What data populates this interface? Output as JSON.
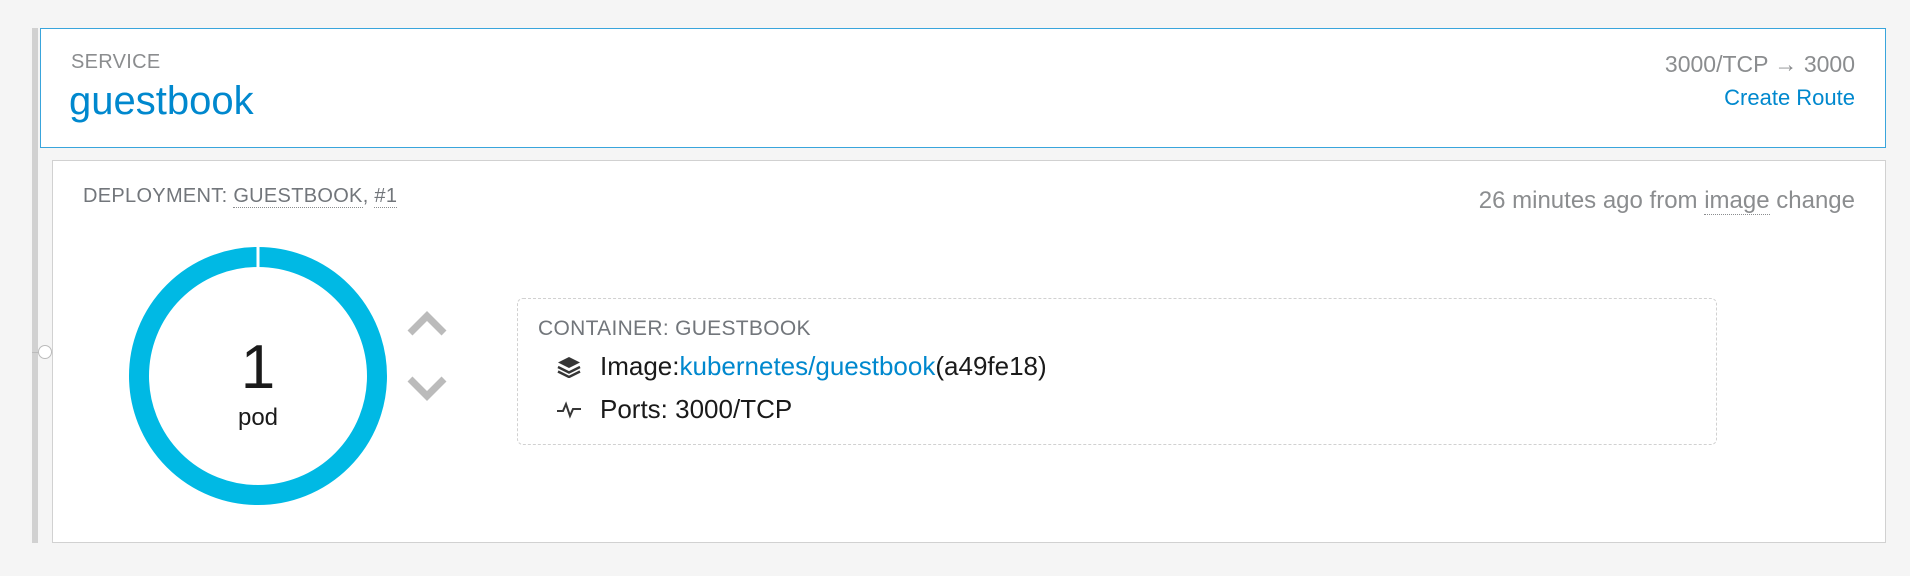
{
  "service": {
    "kind_label": "SERVICE",
    "name": "guestbook",
    "ports": "3000/TCP → 3000",
    "create_route_label": "Create Route"
  },
  "deployment": {
    "label_prefix": "DEPLOYMENT: ",
    "name": "GUESTBOOK",
    "separator": ", ",
    "revision": "#1",
    "time_ago": "26 minutes ago from ",
    "trigger": "image",
    "trigger_suffix": " change",
    "pods": {
      "count": "1",
      "unit_label": "pod",
      "ring_color": "#00b9e4"
    },
    "scale_up_icon": "chevron-up-icon",
    "scale_down_icon": "chevron-down-icon"
  },
  "container": {
    "title": "CONTAINER: GUESTBOOK",
    "image_label": "Image: ",
    "image_link": "kubernetes/guestbook",
    "image_id": " (a49fe18)",
    "image_icon": "layers-icon",
    "ports_label": "Ports: 3000/TCP",
    "ports_icon": "pulse-icon"
  },
  "colors": {
    "link": "#0088ce",
    "accent_border": "#39a5dc",
    "muted_text": "#8b8d8f"
  }
}
